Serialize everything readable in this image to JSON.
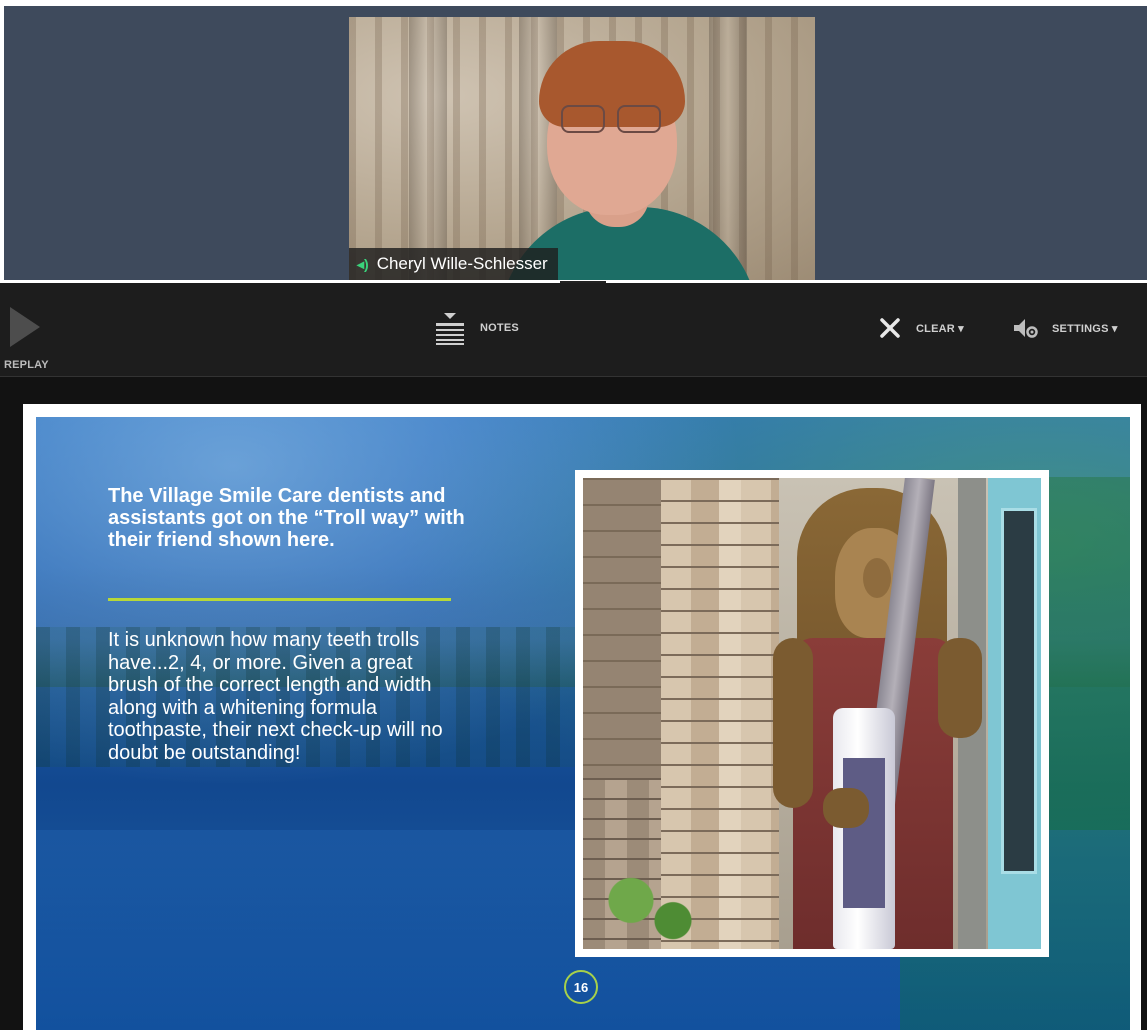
{
  "video": {
    "participant_name": "Cheryl Wille-Schlesser",
    "audio_icon": "speaker-icon"
  },
  "toolbar": {
    "replay_label": "REPLAY",
    "notes_label": "NOTES",
    "clear_label": "CLEAR ▾",
    "settings_label": "SETTINGS ▾",
    "icons": {
      "replay": "play-triangle-icon",
      "notes": "notes-icon",
      "clear": "close-icon",
      "settings": "settings-speaker-icon"
    }
  },
  "slide": {
    "title": "The Village Smile Care dentists and assistants got on the “Troll way” with their friend shown here.",
    "body": "It is unknown how many teeth trolls have...2, 4, or more. Given a great brush of the correct length and width along with a whitening formula toothpaste, their next check-up will no doubt be outstanding!",
    "page_number": "16",
    "accent_color": "#b8d838"
  }
}
